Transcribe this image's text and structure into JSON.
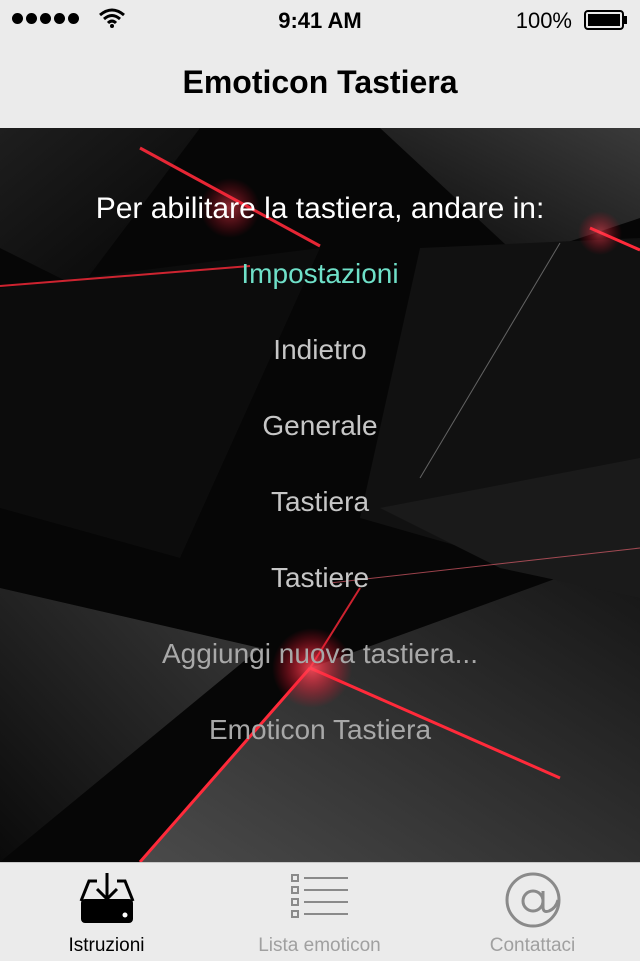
{
  "status_bar": {
    "time": "9:41 AM",
    "battery": "100%",
    "icons": [
      "signal-dots-icon",
      "wifi-icon",
      "battery-icon"
    ]
  },
  "nav": {
    "title": "Emoticon Tastiera"
  },
  "instructions": {
    "heading": "Per abilitare la tastiera, andare in:",
    "steps": [
      "Impostazioni",
      "Indietro",
      "Generale",
      "Tastiera",
      "Tastiere",
      "Aggiungi nuova tastiera...",
      "Emoticon Tastiera"
    ]
  },
  "tab_bar": {
    "tabs": [
      {
        "label": "Istruzioni",
        "icon": "download-tray-icon",
        "selected": true
      },
      {
        "label": "Lista emoticon",
        "icon": "list-icon",
        "selected": false
      },
      {
        "label": "Contattaci",
        "icon": "at-sign-icon",
        "selected": false
      }
    ]
  },
  "colors": {
    "accent": "#6fe0c8",
    "bar_background": "#ebebeb",
    "background": "#050505",
    "red_streak": "#ff2a3a"
  }
}
